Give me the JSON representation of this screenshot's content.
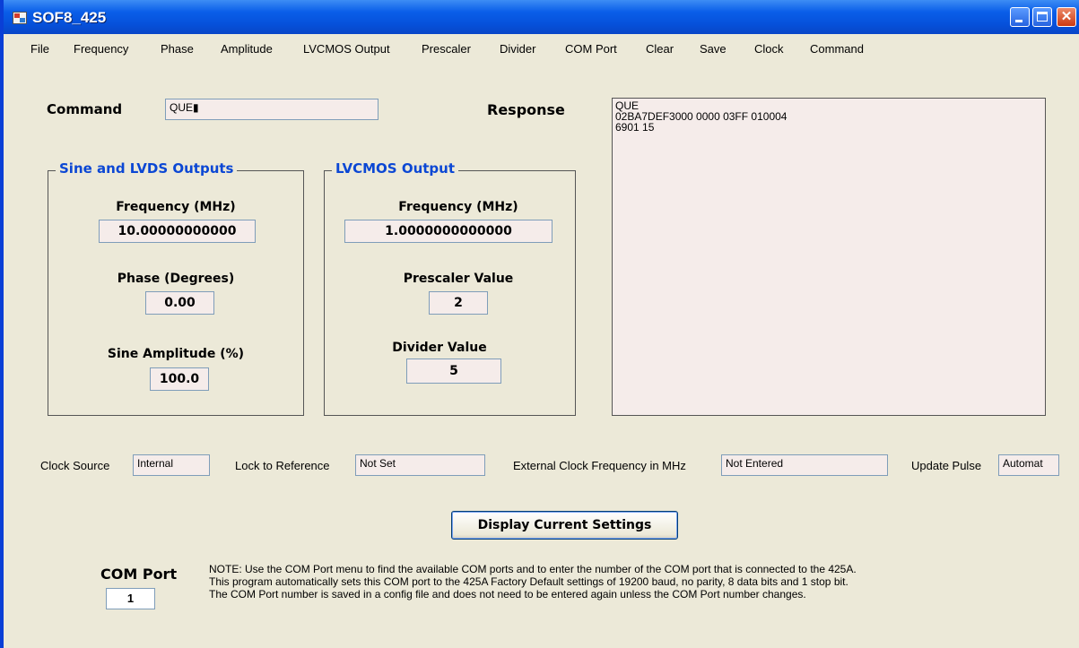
{
  "window": {
    "title": "SOF8_425"
  },
  "menu": [
    "File",
    "Frequency",
    "Phase",
    "Amplitude",
    "LVCMOS Output",
    "Prescaler",
    "Divider",
    "COM Port",
    "Clear",
    "Save",
    "Clock",
    "Command"
  ],
  "command": {
    "label": "Command",
    "value": "QUE▮"
  },
  "response": {
    "label": "Response",
    "lines": [
      "QUE",
      "02BA7DEF3000 0000 03FF 010004",
      "6901 15"
    ]
  },
  "sine_group": {
    "title": "Sine and LVDS Outputs",
    "frequency_label": "Frequency (MHz)",
    "frequency_value": "10.00000000000",
    "phase_label": "Phase (Degrees)",
    "phase_value": "0.00",
    "amplitude_label": "Sine Amplitude (%)",
    "amplitude_value": "100.0"
  },
  "lvcmos_group": {
    "title": "LVCMOS Output",
    "frequency_label": "Frequency (MHz)",
    "frequency_value": "1.0000000000000",
    "prescaler_label": "Prescaler Value",
    "prescaler_value": "2",
    "divider_label": "Divider Value",
    "divider_value": "5"
  },
  "status": {
    "clock_source_label": "Clock Source",
    "clock_source_value": "Internal",
    "lock_label": "Lock to Reference",
    "lock_value": "Not Set",
    "ext_clock_label": "External Clock Frequency in MHz",
    "ext_clock_value": "Not Entered",
    "update_pulse_label": "Update Pulse",
    "update_pulse_value": "Automat"
  },
  "display_button": "Display Current Settings",
  "com_port": {
    "label": "COM Port",
    "value": "1"
  },
  "note_lines": [
    "NOTE: Use the COM Port menu to find the available COM ports and to enter the number of the COM port that is connected to the 425A.",
    "This program automatically sets this COM port to the 425A Factory Default settings of 19200 baud, no parity, 8 data bits and  1 stop bit.",
    "The COM Port number is saved in a config file and does not need to be entered again unless the COM Port number changes."
  ]
}
